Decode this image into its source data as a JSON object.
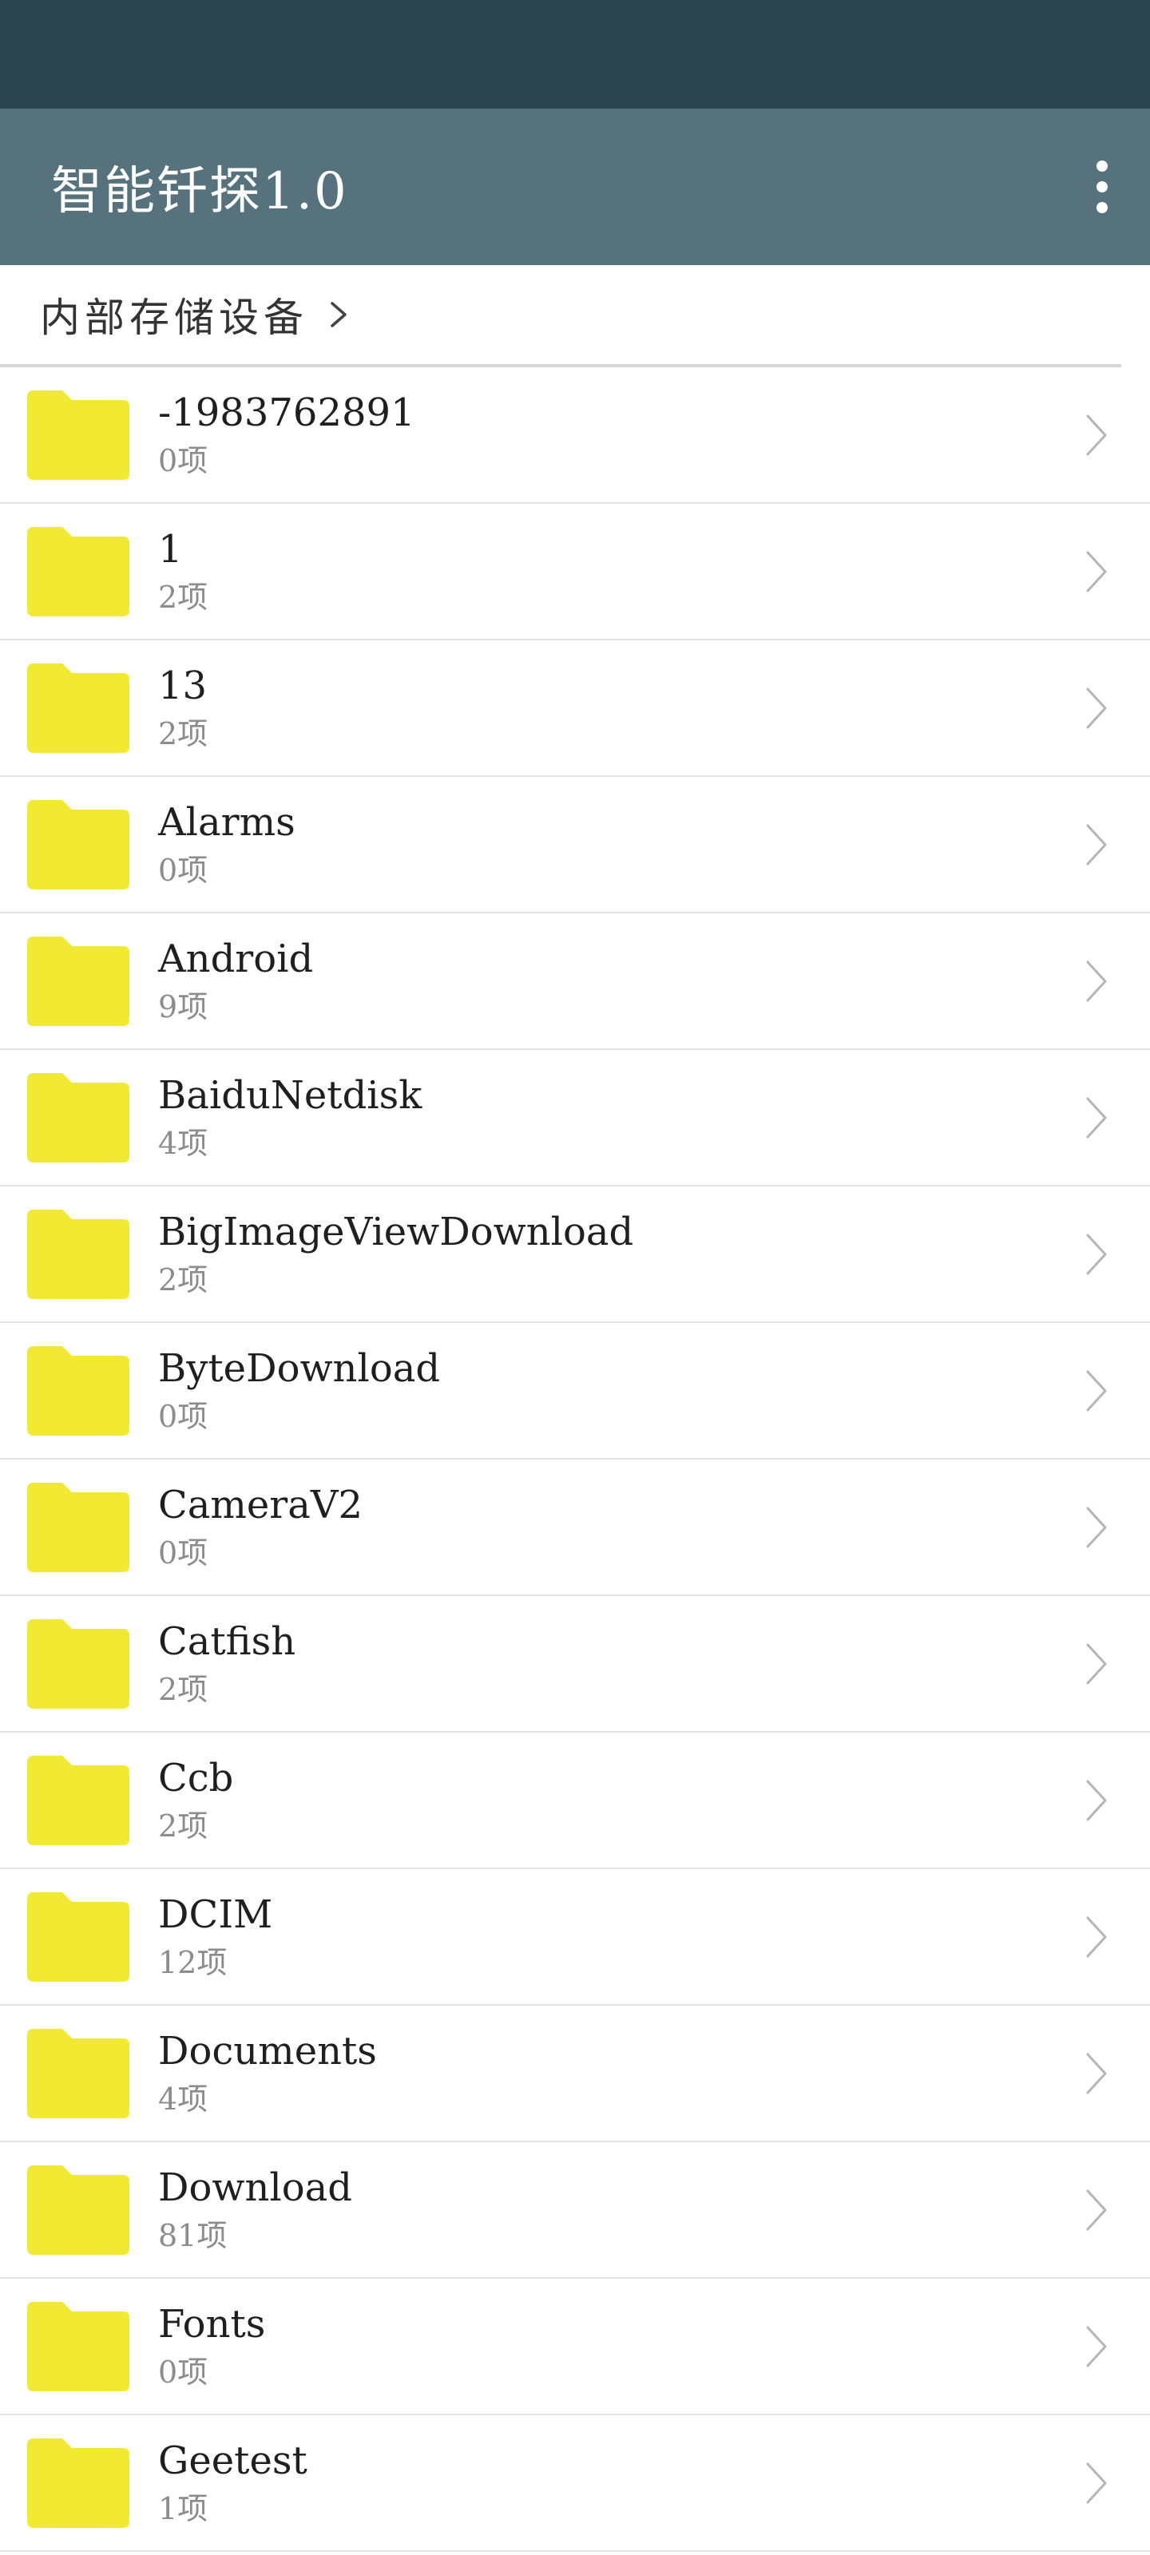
{
  "app": {
    "title": "智能钎探1.0"
  },
  "breadcrumb": {
    "label": "内部存储设备"
  },
  "colors": {
    "status_bar": "#2b4650",
    "toolbar": "#56727c",
    "folder": "#f2e932",
    "chevron": "#b5b5b5"
  },
  "icons": {
    "folder": "folder-icon",
    "chevron": "chevron-right-icon",
    "menu": "more-vert-icon"
  },
  "files": [
    {
      "name": "-1983762891",
      "count": "0项"
    },
    {
      "name": "1",
      "count": "2项"
    },
    {
      "name": "13",
      "count": "2项"
    },
    {
      "name": "Alarms",
      "count": "0项"
    },
    {
      "name": "Android",
      "count": "9项"
    },
    {
      "name": "BaiduNetdisk",
      "count": "4项"
    },
    {
      "name": "BigImageViewDownload",
      "count": "2项"
    },
    {
      "name": "ByteDownload",
      "count": "0项"
    },
    {
      "name": "CameraV2",
      "count": "0项"
    },
    {
      "name": "Catfish",
      "count": "2项"
    },
    {
      "name": "Ccb",
      "count": "2项"
    },
    {
      "name": "DCIM",
      "count": "12项"
    },
    {
      "name": "Documents",
      "count": "4项"
    },
    {
      "name": "Download",
      "count": "81项"
    },
    {
      "name": "Fonts",
      "count": "0项"
    },
    {
      "name": "Geetest",
      "count": "1项"
    }
  ]
}
